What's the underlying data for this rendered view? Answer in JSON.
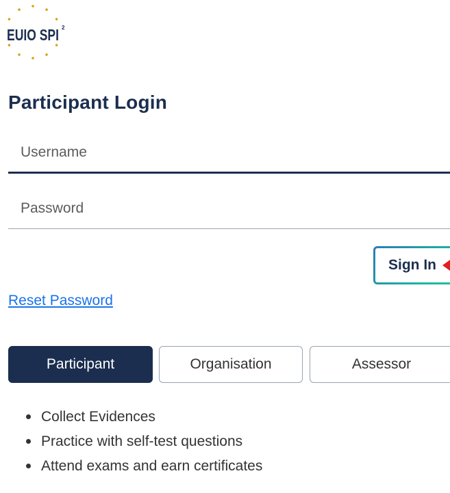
{
  "logo": {
    "text": "EUIO SPI",
    "superscript": "2",
    "star_color": "#d4a21a",
    "text_color": "#1b2e4f"
  },
  "login": {
    "title": "Participant Login",
    "username_placeholder": "Username",
    "password_placeholder": "Password",
    "signin_label": "Sign In",
    "reset_label": "Reset Password"
  },
  "tabs": [
    {
      "label": "Participant",
      "active": true
    },
    {
      "label": "Organisation",
      "active": false
    },
    {
      "label": "Assessor",
      "active": false
    }
  ],
  "features": [
    "Collect Evidences",
    "Practice with self-test questions",
    "Attend exams and earn certificates"
  ],
  "colors": {
    "primary": "#1b2e4f",
    "link": "#1a73e8",
    "accent_gradient_start": "#2b7bb5",
    "accent_gradient_end": "#22c3a1",
    "arrow": "#e02020"
  }
}
